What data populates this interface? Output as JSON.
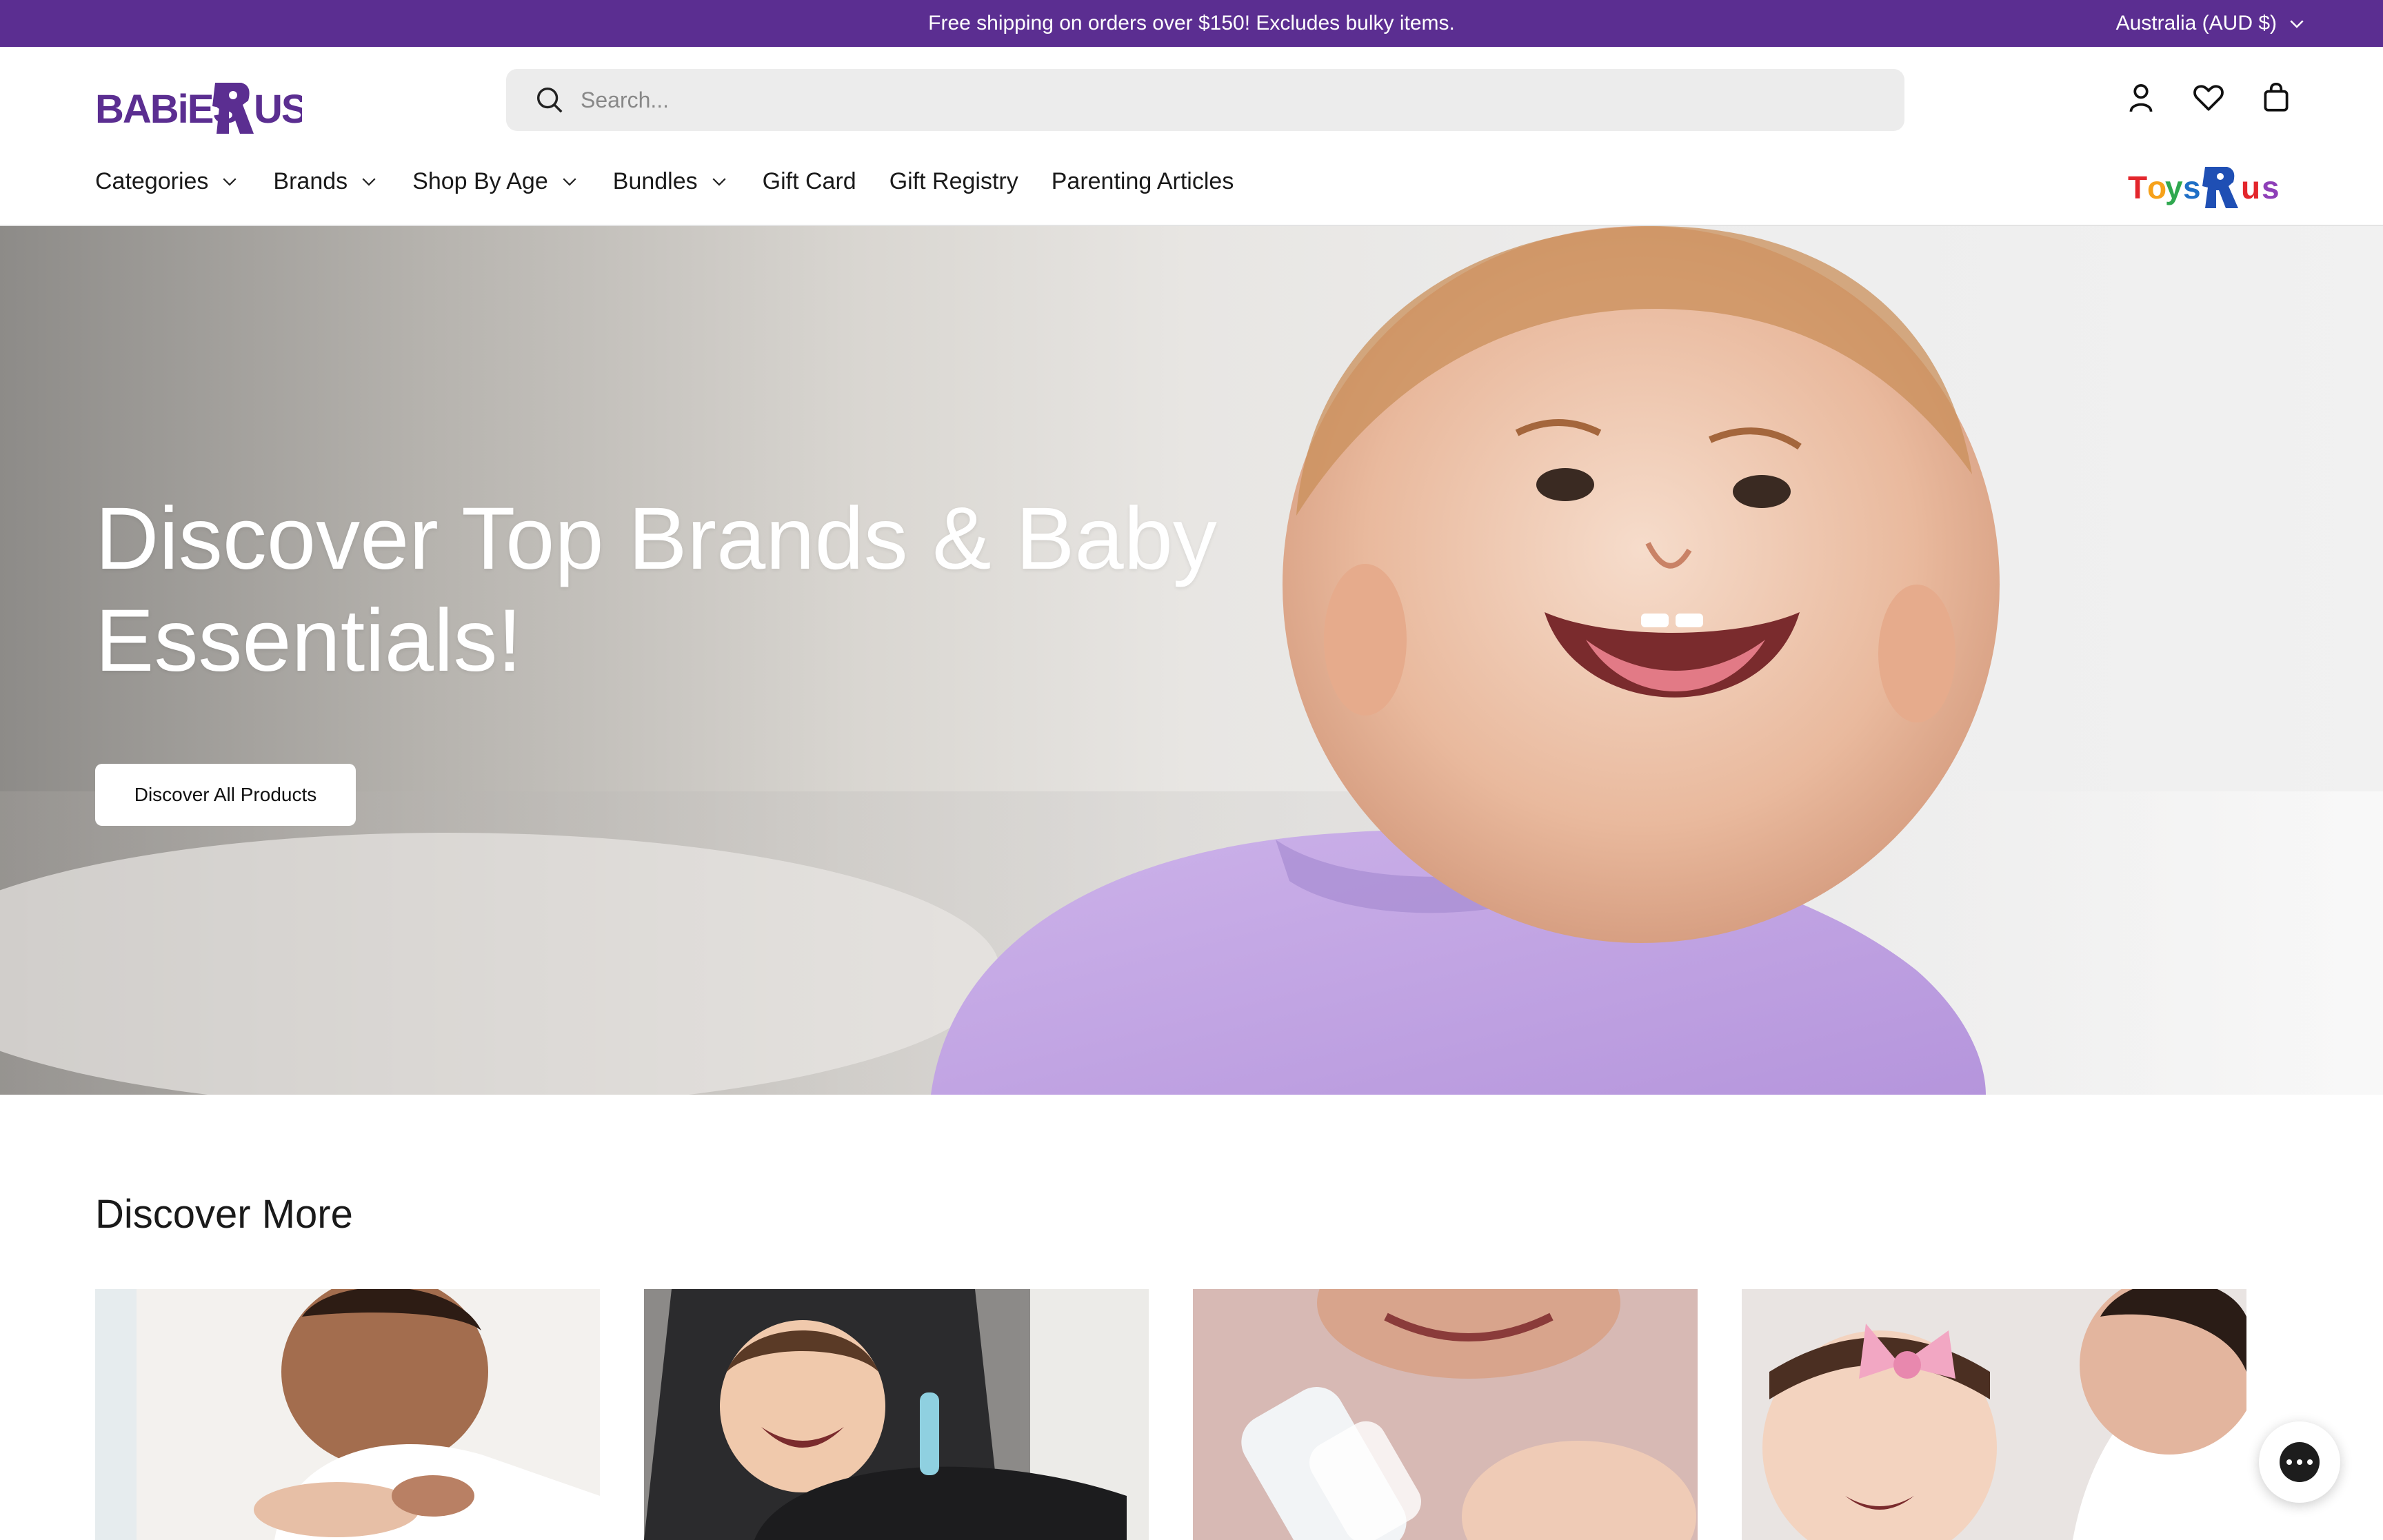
{
  "announcement": {
    "text": "Free shipping on orders over $150! Excludes bulky items.",
    "country_label": "Australia (AUD $)"
  },
  "brand": {
    "logo_text": "BABIES R US",
    "secondary_logo_text": "TOYS R US",
    "accent_color": "#5b2e91"
  },
  "search": {
    "placeholder": "Search..."
  },
  "header_icons": [
    "account-icon",
    "wishlist-heart-icon",
    "cart-bag-icon"
  ],
  "nav": {
    "items": [
      {
        "label": "Categories",
        "dropdown": true
      },
      {
        "label": "Brands",
        "dropdown": true
      },
      {
        "label": "Shop By Age",
        "dropdown": true
      },
      {
        "label": "Bundles",
        "dropdown": true
      },
      {
        "label": "Gift Card",
        "dropdown": false
      },
      {
        "label": "Gift Registry",
        "dropdown": false
      },
      {
        "label": "Parenting Articles",
        "dropdown": false
      }
    ]
  },
  "hero": {
    "title": "Discover Top Brands & Baby Essentials!",
    "button_label": "Discover All Products"
  },
  "discover": {
    "title": "Discover More",
    "cards": [
      "mother-with-baby-feet",
      "baby-in-stroller",
      "mother-bottle-feeding",
      "baby-with-pink-bow"
    ]
  },
  "chat": {
    "icon": "chat-bubble-icon"
  }
}
